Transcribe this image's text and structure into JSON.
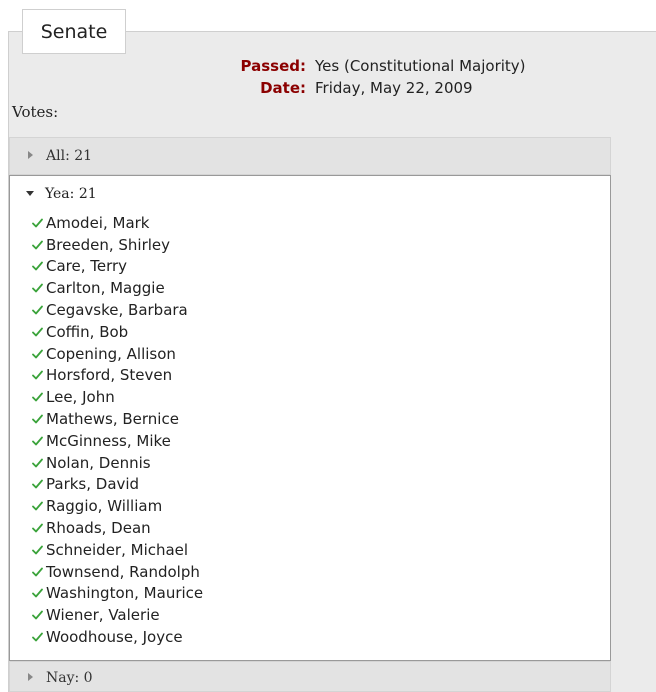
{
  "tab": {
    "label": "Senate"
  },
  "info": {
    "passed_label": "Passed:",
    "passed_value": "Yes (Constitutional Majority)",
    "date_label": "Date:",
    "date_value": "Friday, May 22, 2009"
  },
  "votes_label": "Votes:",
  "sections": {
    "all": "All: 21",
    "yea": "Yea: 21",
    "nay": "Nay: 0"
  },
  "colors": {
    "label_red": "#8b0000",
    "check_green": "#3aa33a"
  },
  "icons": {
    "collapsed": "triangle-right-icon",
    "expanded": "triangle-down-icon",
    "vote": "checkmark-icon"
  },
  "yea_names": [
    "Amodei, Mark",
    "Breeden, Shirley",
    "Care, Terry",
    "Carlton, Maggie",
    "Cegavske, Barbara",
    "Coffin, Bob",
    "Copening, Allison",
    "Horsford, Steven",
    "Lee, John",
    "Mathews, Bernice",
    "McGinness, Mike",
    "Nolan, Dennis",
    "Parks, David",
    "Raggio, William",
    "Rhoads, Dean",
    "Schneider, Michael",
    "Townsend, Randolph",
    "Washington, Maurice",
    "Wiener, Valerie",
    "Woodhouse, Joyce"
  ]
}
